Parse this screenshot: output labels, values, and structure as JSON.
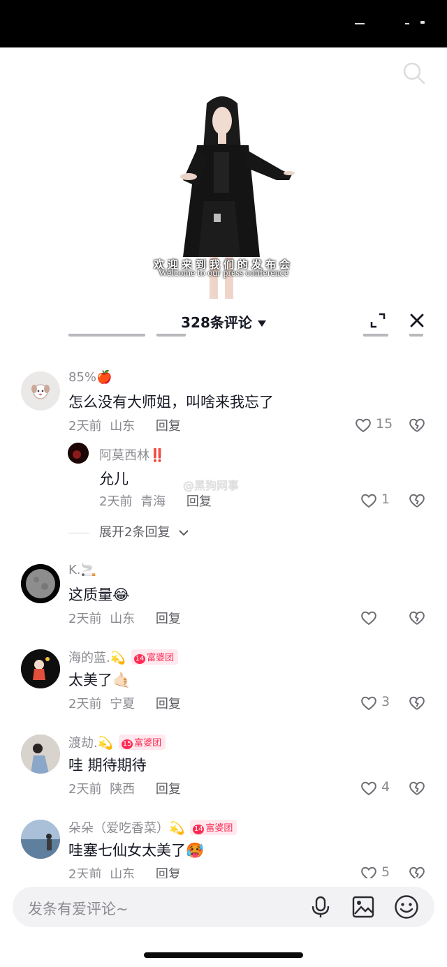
{
  "video": {
    "subtitle_cn": "欢迎来到我们的发布会",
    "subtitle_en": "Welcome to our press conference"
  },
  "sheet": {
    "title": "328条评论"
  },
  "watermark": "@黑狗网事",
  "comments": [
    {
      "username": "85%🍎",
      "text": "怎么没有大师姐，叫啥来我忘了",
      "time": "2天前",
      "location": "山东",
      "reply_label": "回复",
      "likes": "15",
      "avatar_color": "#e9e6e6",
      "replies": [
        {
          "username": "阿莫西林‼️",
          "text": "允儿",
          "time": "2天前",
          "location": "青海",
          "reply_label": "回复",
          "likes": "1",
          "avatar_color": "#2a0a0a"
        }
      ],
      "expand_label": "展开2条回复"
    },
    {
      "username": "K.🚬",
      "text": "这质量😂",
      "time": "2天前",
      "location": "山东",
      "reply_label": "回复",
      "likes": "",
      "avatar_color": "#3a3a3a"
    },
    {
      "username": "海的蓝.💫",
      "badge_num": "14",
      "badge_label": "富婆团",
      "text": "太美了🤙🏻",
      "time": "2天前",
      "location": "宁夏",
      "reply_label": "回复",
      "likes": "3",
      "avatar_color": "#111111"
    },
    {
      "username": "渡劫.💫",
      "badge_num": "15",
      "badge_label": "富婆团",
      "text": "哇 期待期待",
      "time": "2天前",
      "location": "陕西",
      "reply_label": "回复",
      "likes": "4",
      "avatar_color": "#c9c2bd"
    },
    {
      "username": "朵朵（爱吃香菜）💫",
      "badge_num": "14",
      "badge_label": "富婆团",
      "text": "哇塞七仙女太美了🥵",
      "time": "2天前",
      "location": "山东",
      "reply_label": "回复",
      "likes": "5",
      "avatar_color": "#6f8fb0"
    }
  ],
  "input": {
    "placeholder": "发条有爱评论~"
  },
  "icons": {
    "search": "search-icon",
    "expand": "expand-icon",
    "close": "close-icon",
    "like": "heart-outline-icon",
    "dislike": "broken-heart-icon",
    "mic": "microphone-icon",
    "image": "image-icon",
    "emoji": "emoji-icon"
  }
}
